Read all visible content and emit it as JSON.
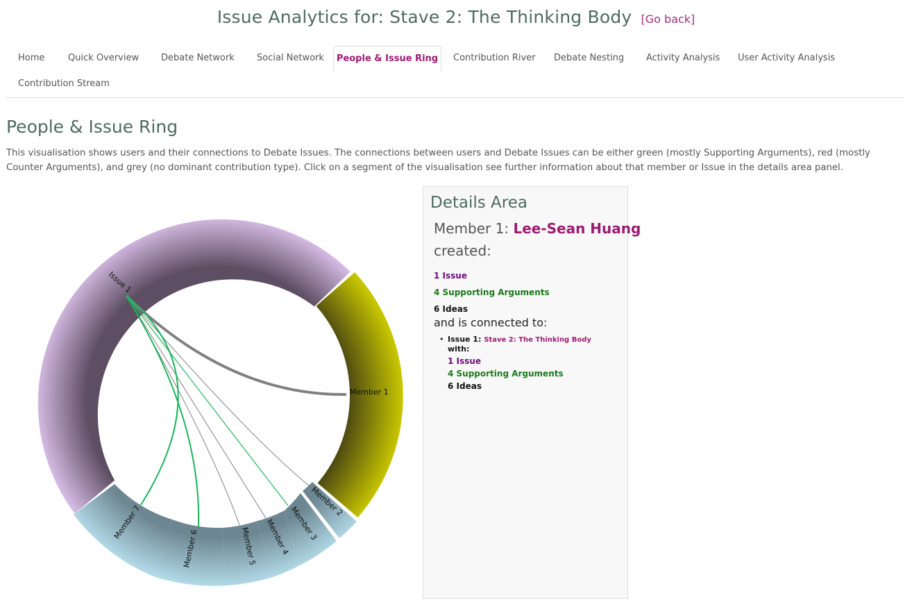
{
  "header": {
    "title": "Issue Analytics for: Stave 2: The Thinking Body",
    "go_back": "[Go back]"
  },
  "tabs": [
    {
      "label": "Home"
    },
    {
      "label": "Quick Overview"
    },
    {
      "label": "Debate Network"
    },
    {
      "label": "Social Network"
    },
    {
      "label": "People & Issue Ring",
      "active": true
    },
    {
      "label": "Contribution River"
    },
    {
      "label": "Debate Nesting"
    },
    {
      "label": "Activity Analysis"
    },
    {
      "label": "User Activity Analysis"
    },
    {
      "label": "Contribution Stream"
    }
  ],
  "page": {
    "title": "People & Issue Ring",
    "description": "This visualisation shows users and their connections to Debate Issues. The connections between users and Debate Issues can be either green (mostly Supporting Arguments), red (mostly Counter Arguments), and grey (no dominant contribution type). Click on a segment of the visualisation see further information about that member or Issue in the details area panel."
  },
  "ring": {
    "segments": [
      "Issue 1",
      "Member 1",
      "Member 2",
      "Member 3",
      "Member 4",
      "Member 5",
      "Member 6",
      "Member 7"
    ],
    "colors": {
      "issue": "#d7bde6",
      "member_selected": "#c6c400",
      "member": "#bfe6f5",
      "green_link": "#1ab55c",
      "grey_link": "#808080"
    }
  },
  "details": {
    "title": "Details Area",
    "member_prefix": "Member 1:",
    "member_name": "Lee-Sean Huang",
    "created_label": "created:",
    "issues": "1 Issue",
    "supporting": "4 Supporting Arguments",
    "ideas": "6 Ideas",
    "connected_label": "and is connected to:",
    "connection": {
      "bullet": "•",
      "issue_label": "Issue 1:",
      "issue_name": "Stave 2: The Thinking Body",
      "with_label": "with:",
      "issues": "1 Issue",
      "supporting": "4 Supporting Arguments",
      "ideas": "6 Ideas"
    }
  }
}
